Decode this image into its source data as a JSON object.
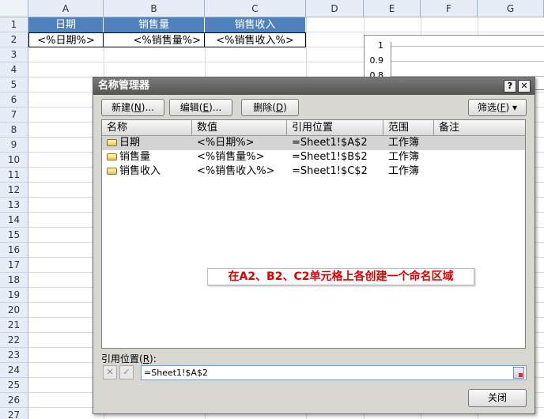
{
  "sheet": {
    "columns": [
      "A",
      "B",
      "C",
      "D",
      "E",
      "F",
      "G"
    ],
    "rows": [
      "1",
      "2",
      "3",
      "4",
      "5",
      "6",
      "7",
      "8",
      "9",
      "10",
      "11",
      "12",
      "13",
      "14",
      "15",
      "16",
      "17",
      "18",
      "19",
      "20",
      "21",
      "22",
      "23",
      "24",
      "25",
      "26",
      "27"
    ],
    "header_row": [
      "日期",
      "销售量",
      "销售收入"
    ],
    "data_row": [
      "<%日期%>",
      "<%销售量%>",
      "<%销售收入%>"
    ],
    "chart": {
      "ticks": [
        "1",
        "0.9",
        "0.8"
      ]
    },
    "colors": {
      "header_fill": "#4f81bd"
    }
  },
  "dialog": {
    "title": "名称管理器",
    "help_label": "?",
    "close_x": "✕",
    "toolbar": {
      "new_label": "新建(",
      "new_key": "N",
      "new_suffix": ")...",
      "edit_label": "编辑(",
      "edit_key": "E",
      "edit_suffix": ")...",
      "delete_label": "删除(",
      "delete_key": "D",
      "delete_suffix": ")",
      "filter_label": "筛选(",
      "filter_key": "F",
      "filter_suffix": ") ▾"
    },
    "list_headers": [
      "名称",
      "数值",
      "引用位置",
      "范围",
      "备注"
    ],
    "names": [
      {
        "name": "日期",
        "value": "<%日期%>",
        "refers_to": "=Sheet1!$A$2",
        "scope": "工作簿",
        "comment": ""
      },
      {
        "name": "销售量",
        "value": "<%销售量%>",
        "refers_to": "=Sheet1!$B$2",
        "scope": "工作簿",
        "comment": ""
      },
      {
        "name": "销售收入",
        "value": "<%销售收入%>",
        "refers_to": "=Sheet1!$C$2",
        "scope": "工作簿",
        "comment": ""
      }
    ],
    "annotation": "在A2、B2、C2单元格上各创建一个命名区域",
    "refers_to_label": "引用位置(",
    "refers_to_key": "R",
    "refers_to_suffix": "):",
    "refers_to_value": "=Sheet1!$A$2",
    "cancel_icon": "✕",
    "confirm_icon": "✓",
    "close_button": "关闭",
    "annotation_color": "#e00000"
  }
}
